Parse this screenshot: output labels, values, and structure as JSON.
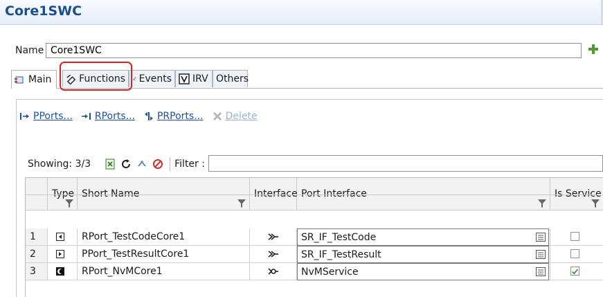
{
  "title": "Core1SWC",
  "name_field": {
    "label": "Name",
    "value": "Core1SWC"
  },
  "tabs": [
    {
      "label": "Main",
      "icon": "component-icon"
    },
    {
      "label": "Functions",
      "icon": "function-icon"
    },
    {
      "label": "Events",
      "icon": "event-icon"
    },
    {
      "label": "IRV",
      "icon": "irv-icon"
    },
    {
      "label": "Others",
      "icon": ""
    }
  ],
  "actions": [
    {
      "label": "PPorts...",
      "icon": "pport-icon",
      "enabled": true
    },
    {
      "label": "RPorts...",
      "icon": "rport-icon",
      "enabled": true
    },
    {
      "label": "PRPorts...",
      "icon": "prport-icon",
      "enabled": true
    },
    {
      "label": "Delete",
      "icon": "delete-icon",
      "enabled": false
    }
  ],
  "toolbar": {
    "showing": "Showing: 3/3",
    "filter_label": "Filter :",
    "filter_value": ""
  },
  "table": {
    "columns": [
      "Type",
      "Short Name",
      "Interface",
      "Port Interface",
      "Is Service"
    ],
    "rows": [
      {
        "num": "1",
        "type": "rport-icon",
        "short_name": "RPort_TestCodeCore1",
        "interface": "sender-receiver-icon",
        "port_interface": "SR_IF_TestCode",
        "is_service": false
      },
      {
        "num": "2",
        "type": "pport-icon",
        "short_name": "PPort_TestResultCore1",
        "interface": "sender-receiver-icon",
        "port_interface": "SR_IF_TestResult",
        "is_service": false
      },
      {
        "num": "3",
        "type": "service-port-icon",
        "short_name": "RPort_NvMCore1",
        "interface": "client-server-icon",
        "port_interface": "NvMService",
        "is_service": true
      }
    ]
  },
  "colors": {
    "title": "#1b4f8f",
    "highlight": "#e0201e",
    "link": "#1f4fa0"
  }
}
